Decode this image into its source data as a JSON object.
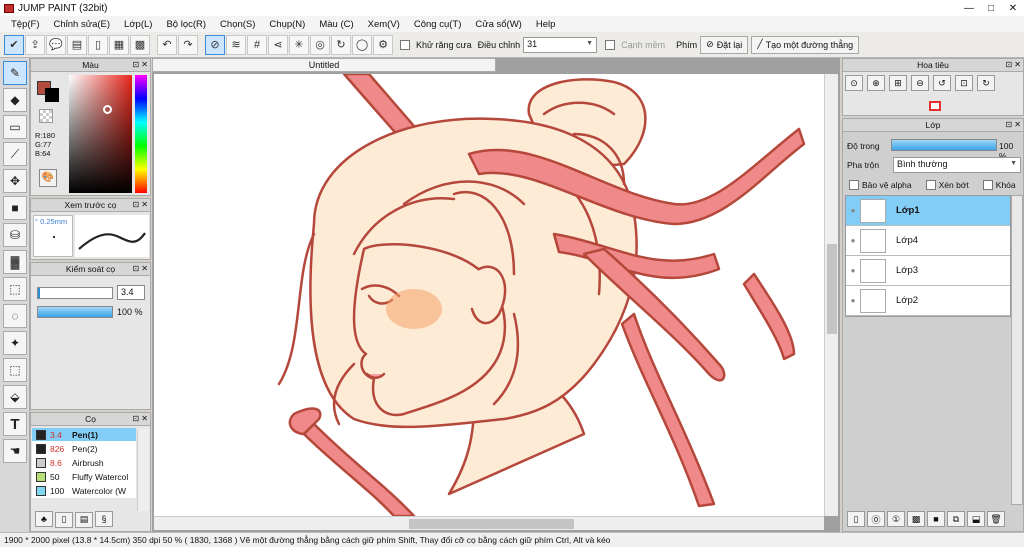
{
  "window": {
    "title": "JUMP PAINT (32bit)"
  },
  "menu": [
    "Tệp(F)",
    "Chỉnh sửa(E)",
    "Lớp(L)",
    "Bộ lọc(R)",
    "Chọn(S)",
    "Chụp(N)",
    "Màu (C)",
    "Xem(V)",
    "Công cụ(T)",
    "Cửa sổ(W)",
    "Help"
  ],
  "toolbar": {
    "antialias_label": "Khử răng cưa",
    "adjust_label": "Điều chỉnh",
    "adjust_value": "31",
    "edge_label": "Cạnh mềm",
    "key_label": "Phím",
    "reset_label": "Đặt lại",
    "line_label": "Tạo một đường thẳng"
  },
  "color_panel": {
    "title": "Màu",
    "r": "R:180",
    "g": "G:77",
    "b": "B:64",
    "fg": "#b44d40",
    "bg": "#000000"
  },
  "preview_panel": {
    "title": "Xem trước cọ",
    "size": "° 0.25mm"
  },
  "brush_control": {
    "title": "Kiểm soát cọ",
    "size_value": "3.4",
    "opacity_value": "100 %"
  },
  "brush_panel": {
    "title": "Cọ",
    "items": [
      {
        "size": "3.4",
        "name": "Pen(1)",
        "color": "#222222"
      },
      {
        "size": "826",
        "name": "Pen(2)",
        "color": "#222222"
      },
      {
        "size": "8.6",
        "name": "Airbrush",
        "color": "#cccccc"
      },
      {
        "size": "50",
        "name": "Fluffy Watercol",
        "color": "#b8e07a"
      },
      {
        "size": "100",
        "name": "Watercolor (W",
        "color": "#7fd8f0"
      }
    ]
  },
  "canvas": {
    "tab_title": "Untitled"
  },
  "navigator": {
    "title": "Hoa tiêu"
  },
  "layer_panel": {
    "title": "Lớp",
    "opacity_label": "Độ trong",
    "opacity_value": "100 %",
    "blend_label": "Pha trộn",
    "blend_value": "Bình thường",
    "protect_alpha": "Bảo vệ alpha",
    "clipping": "Xén bớt",
    "lock": "Khóa",
    "layers": [
      "Lớp1",
      "Lớp4",
      "Lớp3",
      "Lớp2"
    ]
  },
  "status": {
    "text": "1900 * 2000 pixel   (13.8 * 14.5cm)   350 dpi   50 %   ( 1830, 1368 )   Vẽ một đường thẳng bằng cách giữ phím Shift, Thay đổi cỡ cọ bằng cách giữ phím Ctrl, Alt và kéo"
  },
  "colors": {
    "accent": "#82cdf5",
    "ribbon": "#f08a8a",
    "line": "#b5473b",
    "skin": "#fdebd6"
  }
}
